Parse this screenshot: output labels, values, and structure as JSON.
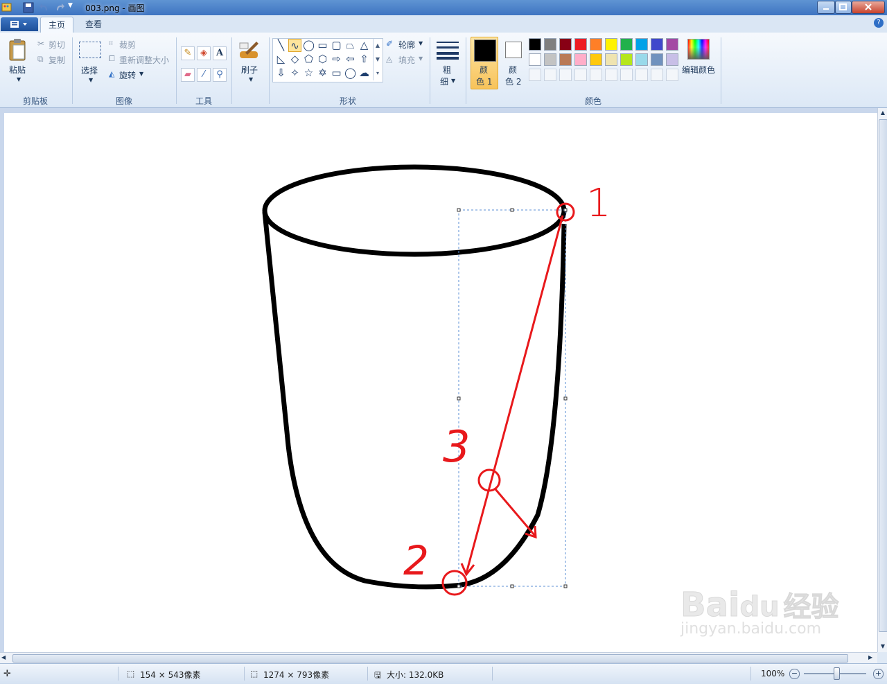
{
  "window": {
    "title": "003.png - 画图"
  },
  "tabs": [
    {
      "label": "主页",
      "active": true
    },
    {
      "label": "查看",
      "active": false
    }
  ],
  "clipboard": {
    "paste_label": "粘贴",
    "cut_label": "剪切",
    "copy_label": "复制",
    "group_label": "剪贴板"
  },
  "image": {
    "select_label": "选择",
    "crop_label": "裁剪",
    "resize_label": "重新调整大小",
    "rotate_label": "旋转",
    "group_label": "图像"
  },
  "tools": {
    "group_label": "工具",
    "brush_label": "刷子"
  },
  "shapes": {
    "outline_label": "轮廓",
    "fill_label": "填充",
    "group_label": "形状"
  },
  "size": {
    "label_1": "粗",
    "label_2": "细"
  },
  "colors": {
    "color1_label_1": "颜",
    "color1_label_2": "色 1",
    "color2_label_1": "颜",
    "color2_label_2": "色 2",
    "edit_label": "编辑颜色",
    "group_label": "颜色",
    "palette_row1": [
      "#000000",
      "#7f7f7f",
      "#880015",
      "#ed1c24",
      "#ff7f27",
      "#fff200",
      "#22b14c",
      "#00a2e8",
      "#3f48cc",
      "#a349a4"
    ],
    "palette_row2": [
      "#ffffff",
      "#c3c3c3",
      "#b97a57",
      "#ffaec9",
      "#ffc90e",
      "#efe4b0",
      "#b5e61d",
      "#99d9ea",
      "#7092be",
      "#c8bfe7"
    ]
  },
  "canvas_annotations": {
    "label_1": "1",
    "label_2": "2",
    "label_3": "3"
  },
  "watermark": {
    "brand": "Bai",
    "brand2": "du",
    "brand3": "经验",
    "url": "jingyan.baidu.com"
  },
  "status": {
    "selection_size": "154 × 543像素",
    "image_size": "1274 × 793像素",
    "file_size": "大小: 132.0KB",
    "zoom": "100%"
  }
}
